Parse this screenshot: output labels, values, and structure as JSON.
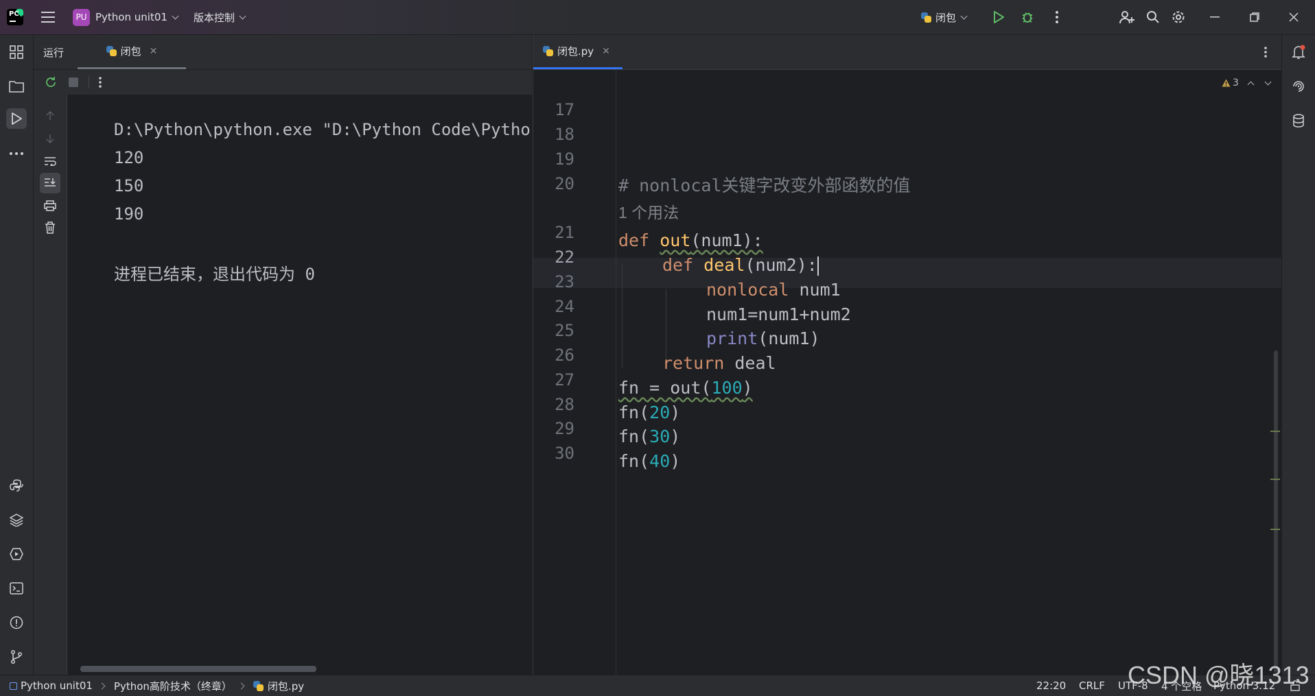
{
  "titlebar": {
    "project_badge": "PU",
    "project_name": "Python unit01",
    "vcs_menu": "版本控制",
    "run_config": "闭包"
  },
  "run_panel": {
    "label": "运行",
    "tab_label": "闭包",
    "output": [
      "D:\\Python\\python.exe \"D:\\Python Code\\Python",
      "120",
      "150",
      "190",
      "",
      "进程已结束，退出代码为 0"
    ]
  },
  "editor": {
    "tab_label": "闭包.py",
    "warnings_count": "3",
    "usage_hint": "1 个用法",
    "line_numbers": [
      "17",
      "18",
      "19",
      "20",
      "21",
      "22",
      "23",
      "24",
      "25",
      "26",
      "27",
      "28",
      "29",
      "30"
    ],
    "code": {
      "l20_comment": "# nonlocal关键字改变外部函数的值",
      "l21_kw": "def",
      "l21_name": "out",
      "l21_rest": "(num1):",
      "l22_kw": "def",
      "l22_name": "deal",
      "l22_rest": "(num2):",
      "l23_kw": "nonlocal",
      "l23_rest": " num1",
      "l24": "num1=num1+num2",
      "l25_fn": "print",
      "l25_rest": "(num1)",
      "l26_kw": "return",
      "l26_rest": " deal",
      "l27_a": "fn = out(",
      "l27_num": "100",
      "l27_b": ")",
      "l28_a": "fn(",
      "l28_num": "20",
      "l28_b": ")",
      "l29_a": "fn(",
      "l29_num": "30",
      "l29_b": ")",
      "l30_a": "fn(",
      "l30_num": "40",
      "l30_b": ")"
    }
  },
  "statusbar": {
    "crumb_project": "Python unit01",
    "crumb_folder": "Python高阶技术（终章）",
    "crumb_file": "闭包.py",
    "position": "22:20",
    "line_sep": "CRLF",
    "encoding": "UTF-8",
    "indent": "4 个空格",
    "interpreter": "Python 3.12"
  },
  "watermark": "CSDN @晓1313",
  "colors": {
    "accent": "#3574f0",
    "keyword": "#cf8e6d",
    "number": "#2aacb8",
    "function_def": "#ffc66d",
    "run_green": "#5fb865"
  }
}
